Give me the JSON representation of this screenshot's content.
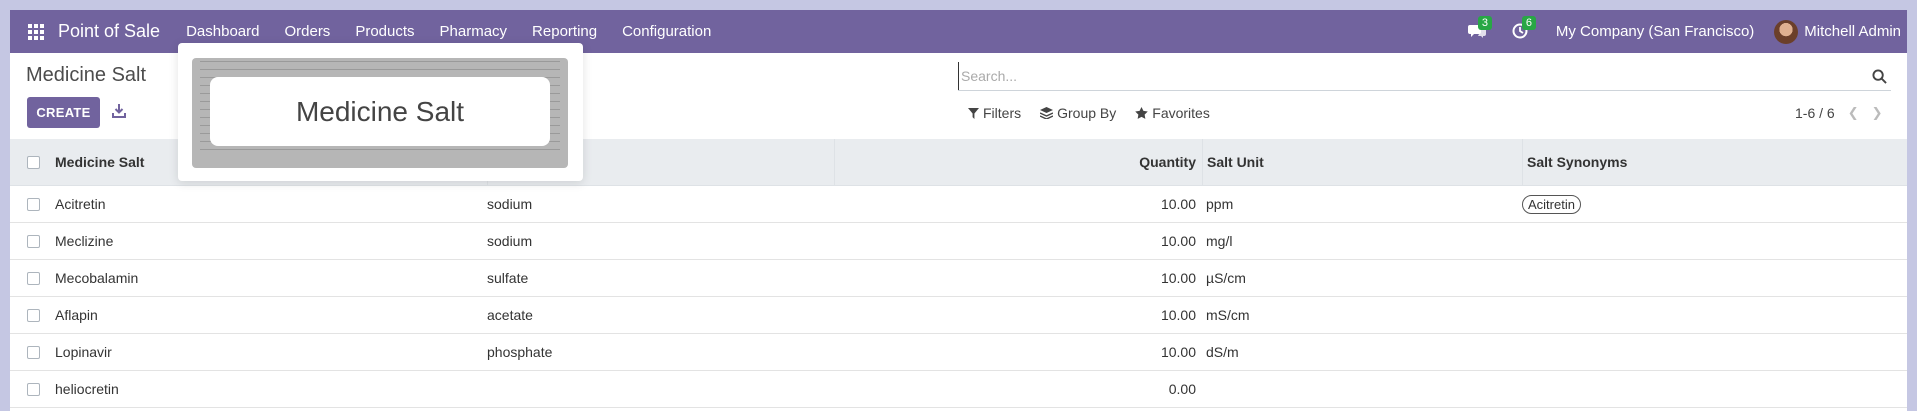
{
  "navbar": {
    "app_name": "Point of Sale",
    "menu": [
      "Dashboard",
      "Orders",
      "Products",
      "Pharmacy",
      "Reporting",
      "Configuration"
    ],
    "messages_count": "3",
    "activities_count": "6",
    "company": "My Company (San Francisco)",
    "user": "Mitchell Admin",
    "accent_color": "#71639e",
    "badge_color": "#28a745"
  },
  "control_panel": {
    "breadcrumb": "Medicine Salt",
    "create_label": "CREATE",
    "search_placeholder": "Search...",
    "filters_label": "Filters",
    "group_by_label": "Group By",
    "favorites_label": "Favorites",
    "pager": "1-6 / 6"
  },
  "table": {
    "columns": {
      "name": "Medicine Salt",
      "type": "",
      "quantity": "Quantity",
      "unit": "Salt Unit",
      "synonyms": "Salt Synonyms"
    },
    "rows": [
      {
        "name": "Acitretin",
        "type": "sodium",
        "quantity": "10.00",
        "unit": "ppm",
        "synonym": "Acitretin"
      },
      {
        "name": "Meclizine",
        "type": "sodium",
        "quantity": "10.00",
        "unit": "mg/l",
        "synonym": ""
      },
      {
        "name": "Mecobalamin",
        "type": "sulfate",
        "quantity": "10.00",
        "unit": "µS/cm",
        "synonym": ""
      },
      {
        "name": "Aflapin",
        "type": "acetate",
        "quantity": "10.00",
        "unit": "mS/cm",
        "synonym": ""
      },
      {
        "name": "Lopinavir",
        "type": "phosphate",
        "quantity": "10.00",
        "unit": "dS/m",
        "synonym": ""
      },
      {
        "name": "heliocretin",
        "type": "",
        "quantity": "0.00",
        "unit": "",
        "synonym": ""
      }
    ]
  },
  "drag_popup": {
    "label": "Medicine Salt"
  }
}
